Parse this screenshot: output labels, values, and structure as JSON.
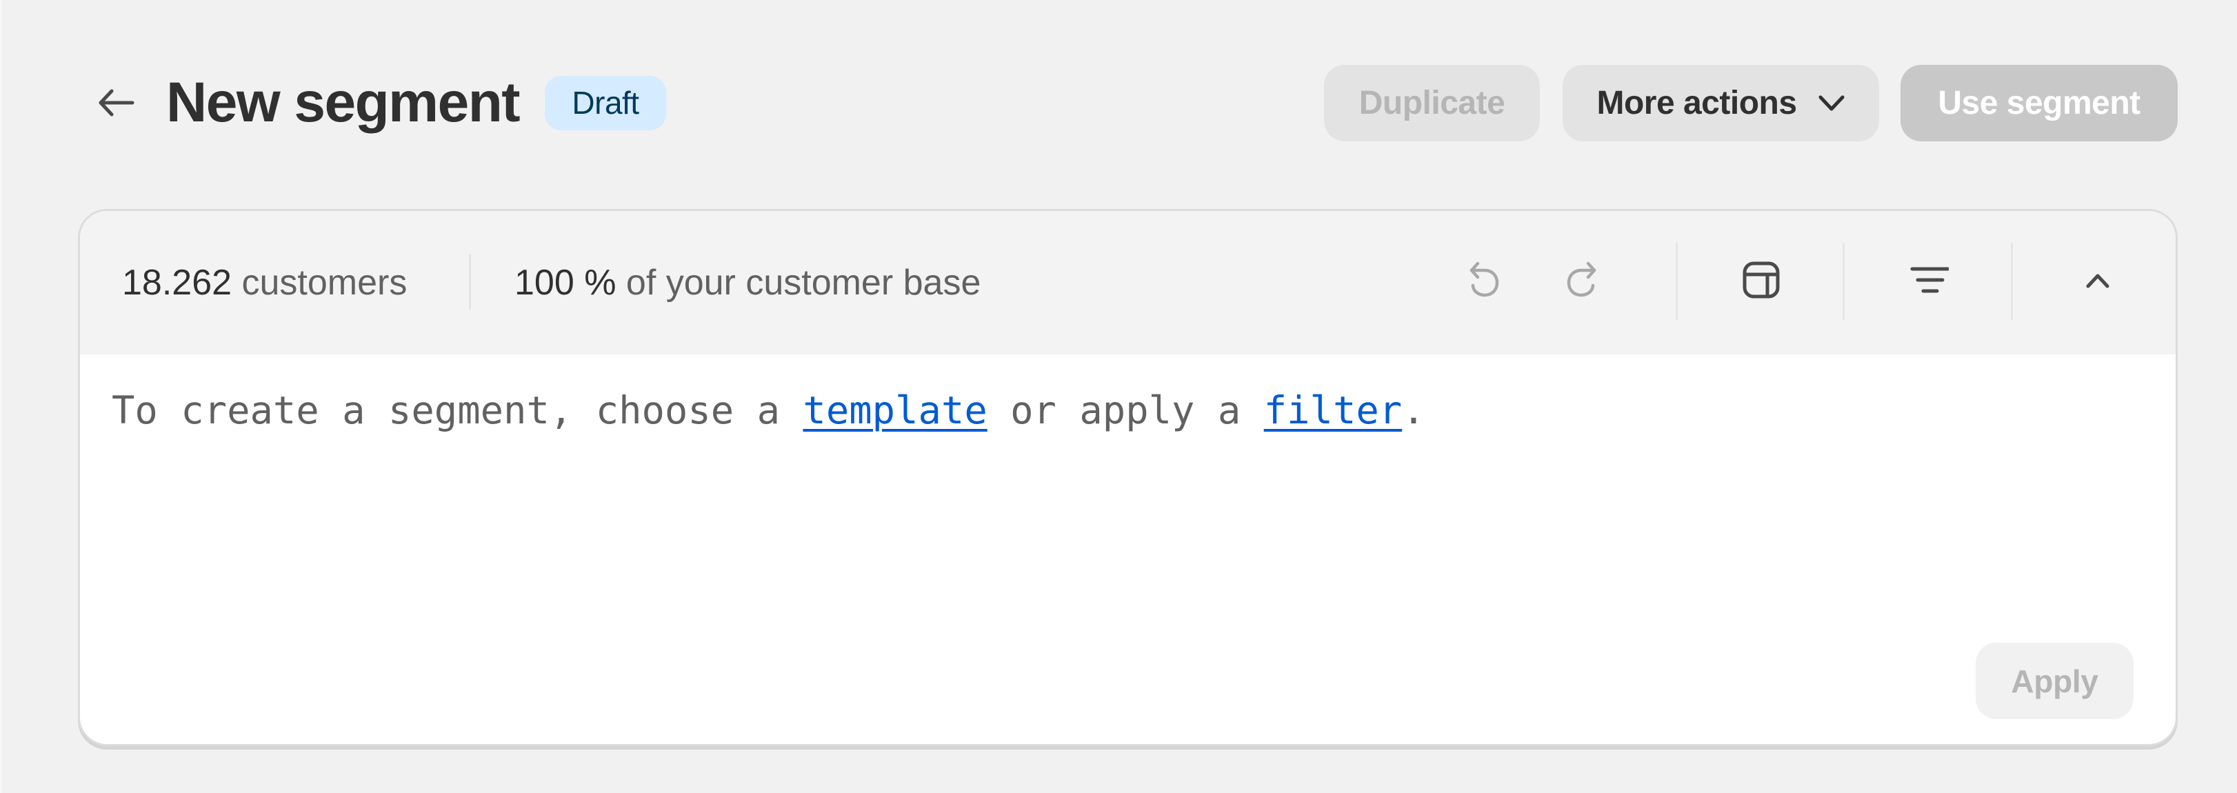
{
  "header": {
    "back_icon": "arrow-left-icon",
    "title": "New segment",
    "status_badge": "Draft",
    "actions": {
      "duplicate_label": "Duplicate",
      "more_actions_label": "More actions",
      "more_actions_icon": "chevron-down-icon",
      "use_segment_label": "Use segment"
    }
  },
  "summary": {
    "customer_count": "18.262",
    "customer_count_label": "customers",
    "percentage": "100 %",
    "percentage_label": "of your customer base"
  },
  "toolbar": {
    "icons": [
      {
        "name": "undo-icon",
        "enabled": false
      },
      {
        "name": "redo-icon",
        "enabled": false
      },
      {
        "name": "template-icon",
        "enabled": true
      },
      {
        "name": "filter-icon",
        "enabled": true
      },
      {
        "name": "chevron-up-icon",
        "enabled": true
      }
    ]
  },
  "editor": {
    "text_before": "To create a segment, choose a ",
    "template_link": "template",
    "text_middle": " or apply a ",
    "filter_link": "filter",
    "text_after": "."
  },
  "footer": {
    "apply_label": "Apply"
  },
  "colors": {
    "page_background": "#f1f1f1",
    "badge_background": "#d5ebff",
    "badge_text": "#003a5a",
    "link": "#005bd3",
    "primary_disabled": "#c8c8c8"
  }
}
